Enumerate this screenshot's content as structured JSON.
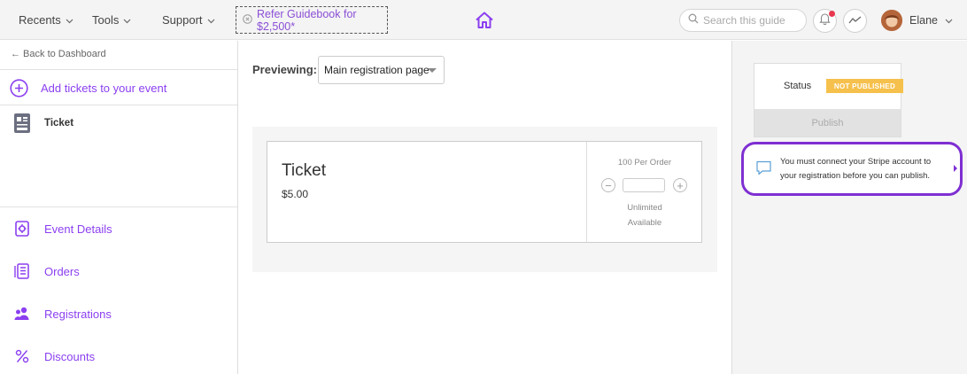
{
  "topbar": {
    "nav": [
      {
        "label": "Recents"
      },
      {
        "label": "Tools"
      },
      {
        "label": "Support"
      }
    ],
    "refer_label": "Refer Guidebook for $2,500*",
    "search_placeholder": "Search this guide",
    "user_name": "Elane"
  },
  "sidebar": {
    "back_label": "← Back to Dashboard",
    "add_tickets_label": "Add tickets to your event",
    "ticket_label": "Ticket",
    "menu": [
      {
        "label": "Event Details",
        "icon": "event-details-icon"
      },
      {
        "label": "Orders",
        "icon": "orders-icon"
      },
      {
        "label": "Registrations",
        "icon": "registrations-icon"
      },
      {
        "label": "Discounts",
        "icon": "percent-icon"
      }
    ]
  },
  "main": {
    "previewing_label": "Previewing:",
    "preview_selected": "Main registration page",
    "ticket": {
      "name": "Ticket",
      "price": "$5.00",
      "per_order": "100 Per Order",
      "availability_line1": "Unlimited",
      "availability_line2": "Available",
      "minus": "−",
      "plus": "+"
    }
  },
  "right": {
    "status_label": "Status",
    "status_badge": "NOT PUBLISHED",
    "publish_label": "Publish",
    "stripe_message": "You must connect your Stripe account to your registration before you can publish."
  },
  "colors": {
    "accent": "#8b3ff0",
    "badge": "#f6c04c",
    "notification": "#e8384f",
    "highlight_border": "#7e2fd2"
  }
}
